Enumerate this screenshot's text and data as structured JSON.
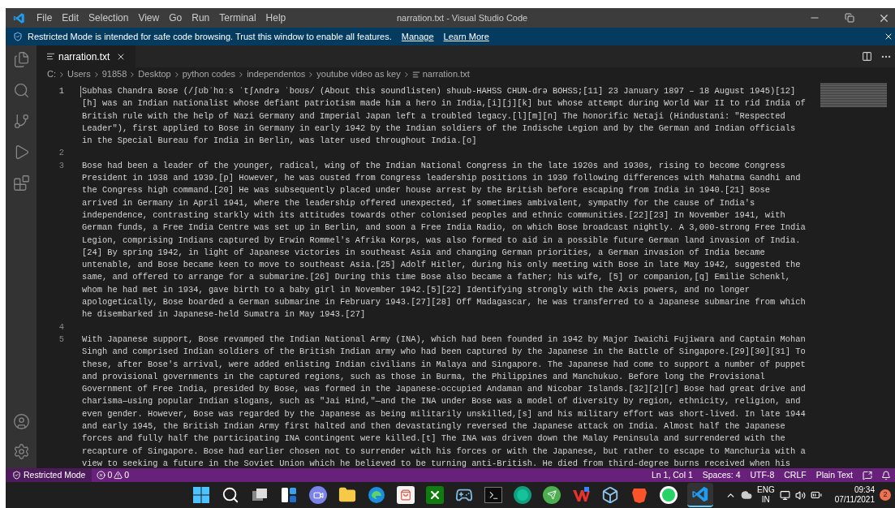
{
  "window": {
    "title": "narration.txt - Visual Studio Code"
  },
  "menu": [
    "File",
    "Edit",
    "Selection",
    "View",
    "Go",
    "Run",
    "Terminal",
    "Help"
  ],
  "banner": {
    "message": "Restricted Mode is intended for safe code browsing. Trust this window to enable all features.",
    "links": [
      "Manage",
      "Learn More"
    ]
  },
  "tabs": [
    {
      "label": "narration.txt",
      "selected": true
    }
  ],
  "breadcrumbs": [
    "C:",
    "Users",
    "91858",
    "Desktop",
    "python codes",
    "independentos",
    "youtube video as key",
    "narration.txt"
  ],
  "editor": {
    "lines": [
      {
        "number": "1",
        "rows": [
          "Subhas Chandra Bose (/ʃʊbˈhɑːs ˈtʃʌndrə ˈboʊs/ (About this soundlisten) shuub-HAHSS CHUN-drə BOHSS;[11] 23 January 1897 – 18 August 1945)[12]",
          "[h] was an Indian nationalist whose defiant patriotism made him a hero in India,[i][j][k] but whose attempt during World War II to rid India of",
          "British rule with the help of Nazi Germany and Imperial Japan left a troubled legacy.[l][m][n] The honorific Netaji (Hindustani: \"Respected",
          "Leader\"), first applied to Bose in Germany in early 1942 by the Indian soldiers of the Indische Legion and by the German and Indian officials",
          "in the Special Bureau for India in Berlin, was later used throughout India.[o]"
        ]
      },
      {
        "number": "2"
      },
      {
        "number": "3",
        "rows": [
          "Bose had been a leader of the younger, radical, wing of the Indian National Congress in the late 1920s and 1930s, rising to become Congress",
          "President in 1938 and 1939.[p] However, he was ousted from Congress leadership positions in 1939 following differences with Mahatma Gandhi and",
          "the Congress high command.[20] He was subsequently placed under house arrest by the British before escaping from India in 1940.[21] Bose",
          "arrived in Germany in April 1941, where the leadership offered unexpected, if sometimes ambivalent, sympathy for the cause of India's",
          "independence, contrasting starkly with its attitudes towards other colonised peoples and ethnic communities.[22][23] In November 1941, with",
          "German funds, a Free India Centre was set up in Berlin, and soon a Free India Radio, on which Bose broadcast nightly. A 3,000-strong Free India",
          "Legion, comprising Indians captured by Erwin Rommel's Afrika Korps, was also formed to aid in a possible future German land invasion of India.",
          "[24] By spring 1942, in light of Japanese victories in southeast Asia and changing German priorities, a German invasion of India became",
          "untenable, and Bose became keen to move to southeast Asia.[25] Adolf Hitler, during his only meeting with Bose in late May 1942, suggested the",
          "same, and offered to arrange for a submarine.[26] During this time Bose also became a father; his wife, [5] or companion,[q] Emilie Schenkl,",
          "whom he had met in 1934, gave birth to a baby girl in November 1942.[5][22] Identifying strongly with the Axis powers, and no longer",
          "apologetically, Bose boarded a German submarine in February 1943.[27][28] Off Madagascar, he was transferred to a Japanese submarine from which",
          "he disembarked in Japanese-held Sumatra in May 1943.[27]"
        ]
      },
      {
        "number": "4"
      },
      {
        "number": "5",
        "rows": [
          "With Japanese support, Bose revamped the Indian National Army (INA), which had been founded in 1942 by Major Iwaichi Fujiwara and Captain Mohan",
          "Singh and comprised Indian soldiers of the British Indian army who had been captured by the Japanese in the Battle of Singapore.[29][30][31] To",
          "these, after Bose's arrival, were added enlisting Indian civilians in Malaya and Singapore. The Japanese had come to support a number of puppet",
          "and provisional governments in the captured regions, such as those in Burma, the Philippines and Manchukuo. Before long the Provisional",
          "Government of Free India, presided by Bose, was formed in the Japanese-occupied Andaman and Nicobar Islands.[32][2][r] Bose had great drive and",
          "charisma—using popular Indian slogans, such as \"Jai Hind,\"—and the INA under Bose was a model of diversity by region, ethnicity, religion, and",
          "even gender. However, Bose was regarded by the Japanese as being militarily unskilled,[s] and his military effort was short-lived. In late 1944",
          "and early 1945, the British Indian Army first halted and then devastatingly reversed the Japanese attack on India. Almost half the Japanese",
          "forces and fully half the participating INA contingent were killed.[t] The INA was driven down the Malay Peninsula and surrendered with the",
          "recapture of Singapore. Bose had earlier chosen not to surrender with his forces or with the Japanese, but rather to escape to Manchuria with a",
          "view to seeking a future in the Soviet Union which he believed to be turning anti-British. He died from third-degree burns received when his"
        ]
      }
    ]
  },
  "status_bar": {
    "restricted": "Restricted Mode",
    "errors": "0",
    "warnings": "0",
    "items": [
      "Ln 1, Col 1",
      "Spaces: 4",
      "UTF-8",
      "CRLF",
      "Plain Text"
    ]
  },
  "taskbar": {
    "apps": [
      {
        "kind": "start",
        "selected": false
      },
      {
        "kind": "search",
        "selected": false
      },
      {
        "kind": "taskview",
        "selected": false
      },
      {
        "kind": "widgets",
        "selected": false
      },
      {
        "kind": "chat",
        "selected": false
      },
      {
        "kind": "folder",
        "selected": false
      },
      {
        "kind": "browser",
        "selected": false
      },
      {
        "kind": "store",
        "selected": false
      },
      {
        "kind": "xbox",
        "selected": false
      },
      {
        "kind": "gamepad",
        "selected": false
      },
      {
        "kind": "terminal",
        "selected": false
      },
      {
        "kind": "grammar",
        "selected": false
      },
      {
        "kind": "send",
        "selected": false
      },
      {
        "kind": "office",
        "selected": false
      },
      {
        "kind": "cube",
        "selected": false
      },
      {
        "kind": "lion",
        "selected": false
      },
      {
        "kind": "whatsapp",
        "selected": false
      },
      {
        "kind": "vscode",
        "selected": true
      }
    ],
    "language": "ENG",
    "region": "IN",
    "time": "09:34",
    "date": "07/11/2021",
    "notifications": "2"
  }
}
